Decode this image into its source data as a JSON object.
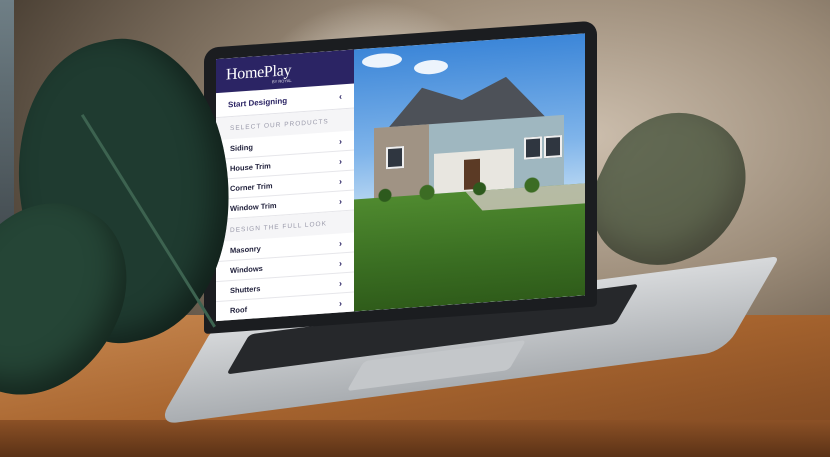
{
  "app": {
    "logo": "HomePlay",
    "logo_sub": "BY ROYAL"
  },
  "sidebar": {
    "start_label": "Start Designing",
    "products_heading": "SELECT OUR PRODUCTS",
    "products": [
      {
        "label": "Siding"
      },
      {
        "label": "House Trim"
      },
      {
        "label": "Corner Trim"
      },
      {
        "label": "Window Trim"
      }
    ],
    "look_heading": "DESIGN THE FULL LOOK",
    "look": [
      {
        "label": "Masonry"
      },
      {
        "label": "Windows"
      },
      {
        "label": "Shutters"
      },
      {
        "label": "Roof"
      }
    ]
  },
  "icons": {
    "collapse": "chevron-left-icon",
    "item": "chevron-right-icon"
  },
  "colors": {
    "brand": "#2b2464",
    "section_text": "#9a9aaa"
  }
}
